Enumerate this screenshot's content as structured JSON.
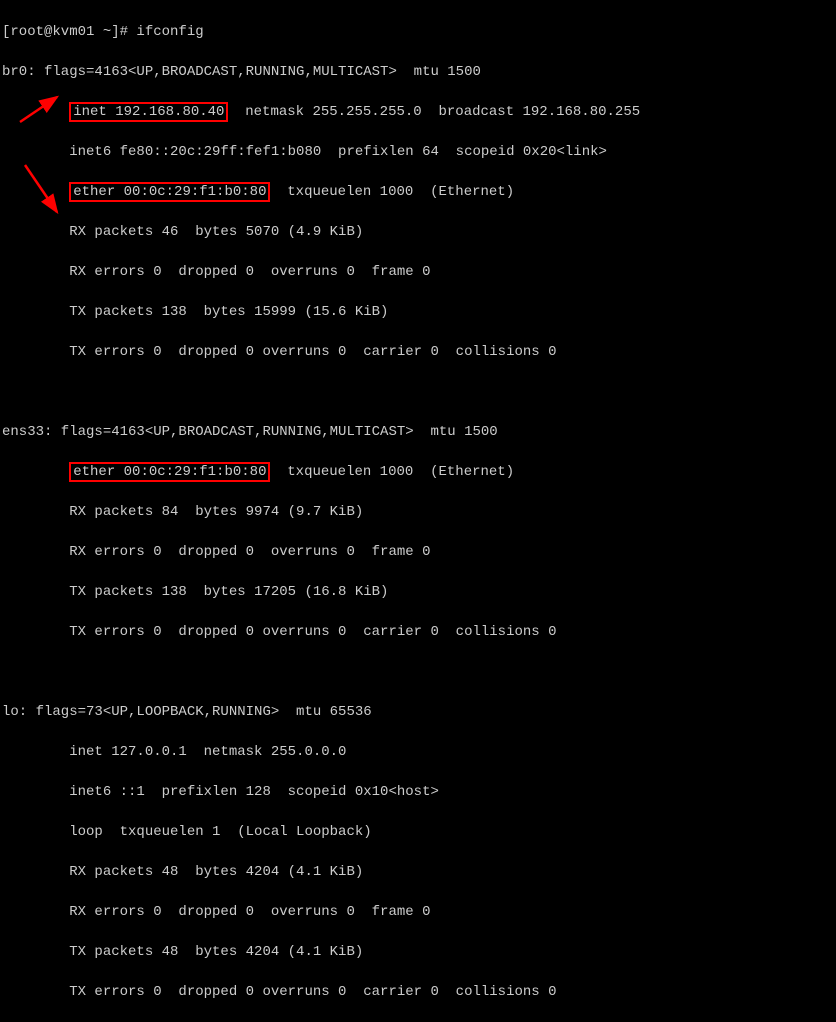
{
  "prompt": "[root@kvm01 ~]# ",
  "command": "ifconfig",
  "br0": {
    "header": "br0: flags=4163<UP,BROADCAST,RUNNING,MULTICAST>  mtu 1500",
    "inet_label": "inet",
    "inet_value": "192.168.80.40",
    "inet_rest": "  netmask 255.255.255.0  broadcast 192.168.80.255",
    "inet6": "        inet6 fe80::20c:29ff:fef1:b080  prefixlen 64  scopeid 0x20<link>",
    "ether_label": "ether",
    "ether_value": "00:0c:29:f1:b0:80",
    "ether_rest": "  txqueuelen 1000  (Ethernet)",
    "rx_packets": "        RX packets 46  bytes 5070 (4.9 KiB)",
    "rx_errors": "        RX errors 0  dropped 0  overruns 0  frame 0",
    "tx_packets": "        TX packets 138  bytes 15999 (15.6 KiB)",
    "tx_errors": "        TX errors 0  dropped 0 overruns 0  carrier 0  collisions 0"
  },
  "ens33": {
    "header": "ens33: flags=4163<UP,BROADCAST,RUNNING,MULTICAST>  mtu 1500",
    "ether_label": "ether",
    "ether_value": "00:0c:29:f1:b0:80",
    "ether_rest": "  txqueuelen 1000  (Ethernet)",
    "rx_packets": "        RX packets 84  bytes 9974 (9.7 KiB)",
    "rx_errors": "        RX errors 0  dropped 0  overruns 0  frame 0",
    "tx_packets": "        TX packets 138  bytes 17205 (16.8 KiB)",
    "tx_errors": "        TX errors 0  dropped 0 overruns 0  carrier 0  collisions 0"
  },
  "lo": {
    "header": "lo: flags=73<UP,LOOPBACK,RUNNING>  mtu 65536",
    "inet": "        inet 127.0.0.1  netmask 255.0.0.0",
    "inet6": "        inet6 ::1  prefixlen 128  scopeid 0x10<host>",
    "loop": "        loop  txqueuelen 1  (Local Loopback)",
    "rx_packets": "        RX packets 48  bytes 4204 (4.1 KiB)",
    "rx_errors": "        RX errors 0  dropped 0  overruns 0  frame 0",
    "tx_packets": "        TX packets 48  bytes 4204 (4.1 KiB)",
    "tx_errors": "        TX errors 0  dropped 0 overruns 0  carrier 0  collisions 0"
  }
}
